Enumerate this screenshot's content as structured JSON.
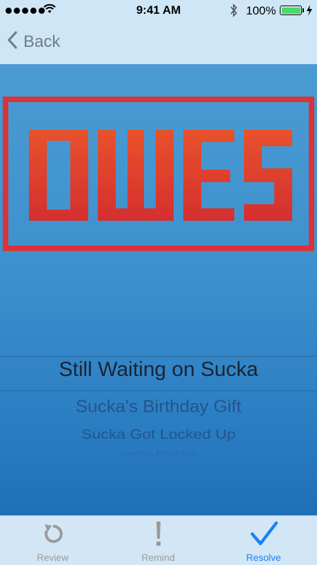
{
  "status_bar": {
    "time": "9:41 AM",
    "battery_percent": "100%",
    "signal_bars": 5,
    "icons": [
      "signal-dots-icon",
      "wifi-icon",
      "bluetooth-icon",
      "battery-icon",
      "charging-icon"
    ]
  },
  "nav": {
    "back_label": "Back",
    "back_icon": "chevron-left-icon"
  },
  "logo": {
    "text": "OWES",
    "color": "#e23b2f"
  },
  "picker": {
    "selected": "Still Waiting on Sucka",
    "options": [
      "Sucka's Birthday Gift",
      "Sucka Got Locked Up",
      "Sucka Paid Up"
    ]
  },
  "tab_bar": {
    "tabs": [
      {
        "label": "Review",
        "icon": "refresh-icon",
        "active": false
      },
      {
        "label": "Remind",
        "icon": "exclamation-icon",
        "active": false
      },
      {
        "label": "Resolve",
        "icon": "checkmark-icon",
        "active": true
      }
    ],
    "active_color": "#1a82f7",
    "inactive_color": "#9a9a9a"
  },
  "colors": {
    "bar_background": "#cfe6f6",
    "main_gradient_top": "#4b9bd2",
    "main_gradient_bottom": "#1f6fb6"
  }
}
